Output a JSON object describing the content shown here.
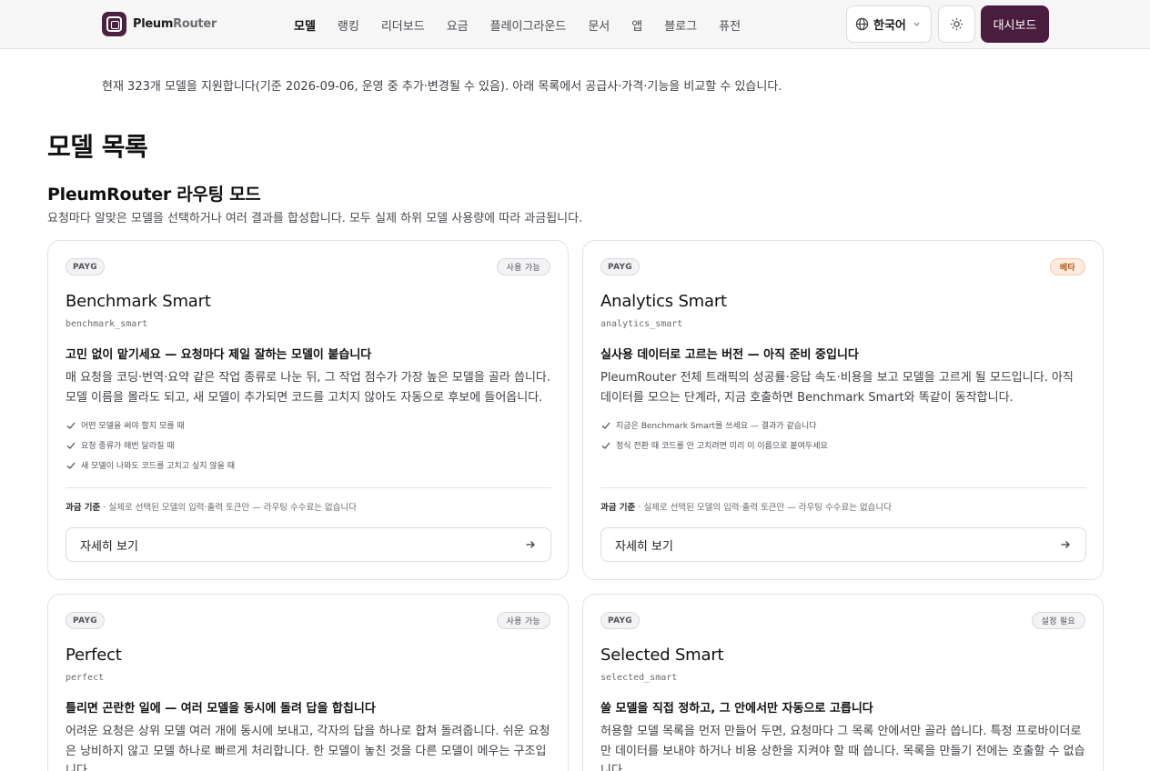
{
  "brand": {
    "name_part1": "Pleum",
    "name_part2": "Router"
  },
  "nav": [
    "모델",
    "랭킹",
    "리더보드",
    "요금",
    "플레이그라운드",
    "문서",
    "앱",
    "블로그",
    "퓨전"
  ],
  "header": {
    "language": "한국어",
    "dashboard": "대시보드"
  },
  "intro": "현재 323개 모델을 지원합니다(기준 2026-09-06, 운영 중 추가·변경될 수 있음). 아래 목록에서 공급사·가격·기능을 비교할 수 있습니다.",
  "page_title": "모델 목록",
  "section": {
    "title": "PleumRouter 라우팅 모드",
    "subtitle": "요청마다 알맞은 모델을 선택하거나 여러 결과를 합성합니다. 모두 실제 하위 모델 사용량에 따라 과금됩니다."
  },
  "colors": {
    "accent": "#4a1d3e",
    "beta_tag": "#fdecdf"
  },
  "cards": [
    {
      "badge": "PAYG",
      "status": "사용 가능",
      "status_kind": "available",
      "title": "Benchmark Smart",
      "id": "benchmark_smart",
      "headline": "고민 없이 맡기세요 — 요청마다 제일 잘하는 모델이 붙습니다",
      "desc": "매 요청을 코딩·번역·요약 같은 작업 종류로 나눈 뒤, 그 작업 점수가 가장 높은 모델을 골라 씁니다. 모델 이름을 몰라도 되고, 새 모델이 추가되면 코드를 고치지 않아도 자동으로 후보에 들어옵니다.",
      "features": [
        "어떤 모델을 써야 할지 모를 때",
        "요청 종류가 매번 달라질 때",
        "새 모델이 나와도 코드를 고치고 싶지 않을 때"
      ],
      "billing_label": "과금 기준",
      "billing_text": "· 실제로 선택된 모델의 입력·출력 토큰만 — 라우팅 수수료는 없습니다",
      "more": "자세히 보기"
    },
    {
      "badge": "PAYG",
      "status": "베타",
      "status_kind": "beta",
      "title": "Analytics Smart",
      "id": "analytics_smart",
      "headline": "실사용 데이터로 고르는 버전 — 아직 준비 중입니다",
      "desc": "PleumRouter 전체 트래픽의 성공률·응답 속도·비용을 보고 모델을 고르게 될 모드입니다. 아직 데이터를 모으는 단계라, 지금 호출하면 Benchmark Smart와 똑같이 동작합니다.",
      "features": [
        "지금은 Benchmark Smart를 쓰세요 — 결과가 같습니다",
        "정식 전환 때 코드를 안 고치려면 미리 이 이름으로 붙여두세요"
      ],
      "billing_label": "과금 기준",
      "billing_text": "· 실제로 선택된 모델의 입력·출력 토큰만 — 라우팅 수수료는 없습니다",
      "more": "자세히 보기"
    },
    {
      "badge": "PAYG",
      "status": "사용 가능",
      "status_kind": "available",
      "title": "Perfect",
      "id": "perfect",
      "headline": "틀리면 곤란한 일에 — 여러 모델을 동시에 돌려 답을 합칩니다",
      "desc": "어려운 요청은 상위 모델 여러 개에 동시에 보내고, 각자의 답을 하나로 합쳐 돌려줍니다. 쉬운 요청은 낭비하지 않고 모델 하나로 빠르게 처리합니다. 한 모델이 놓친 것을 다른 모델이 메우는 구조입니다.",
      "features": [],
      "billing_label": "",
      "billing_text": "",
      "more": ""
    },
    {
      "badge": "PAYG",
      "status": "설정 필요",
      "status_kind": "setup",
      "title": "Selected Smart",
      "id": "selected_smart",
      "headline": "쓸 모델을 직접 정하고, 그 안에서만 자동으로 고릅니다",
      "desc": "허용할 모델 목록을 먼저 만들어 두면, 요청마다 그 목록 안에서만 골라 씁니다. 특정 프로바이더로만 데이터를 보내야 하거나 비용 상한을 지켜야 할 때 씁니다. 목록을 만들기 전에는 호출할 수 없습니다.",
      "features": [],
      "billing_label": "",
      "billing_text": "",
      "more": ""
    }
  ]
}
